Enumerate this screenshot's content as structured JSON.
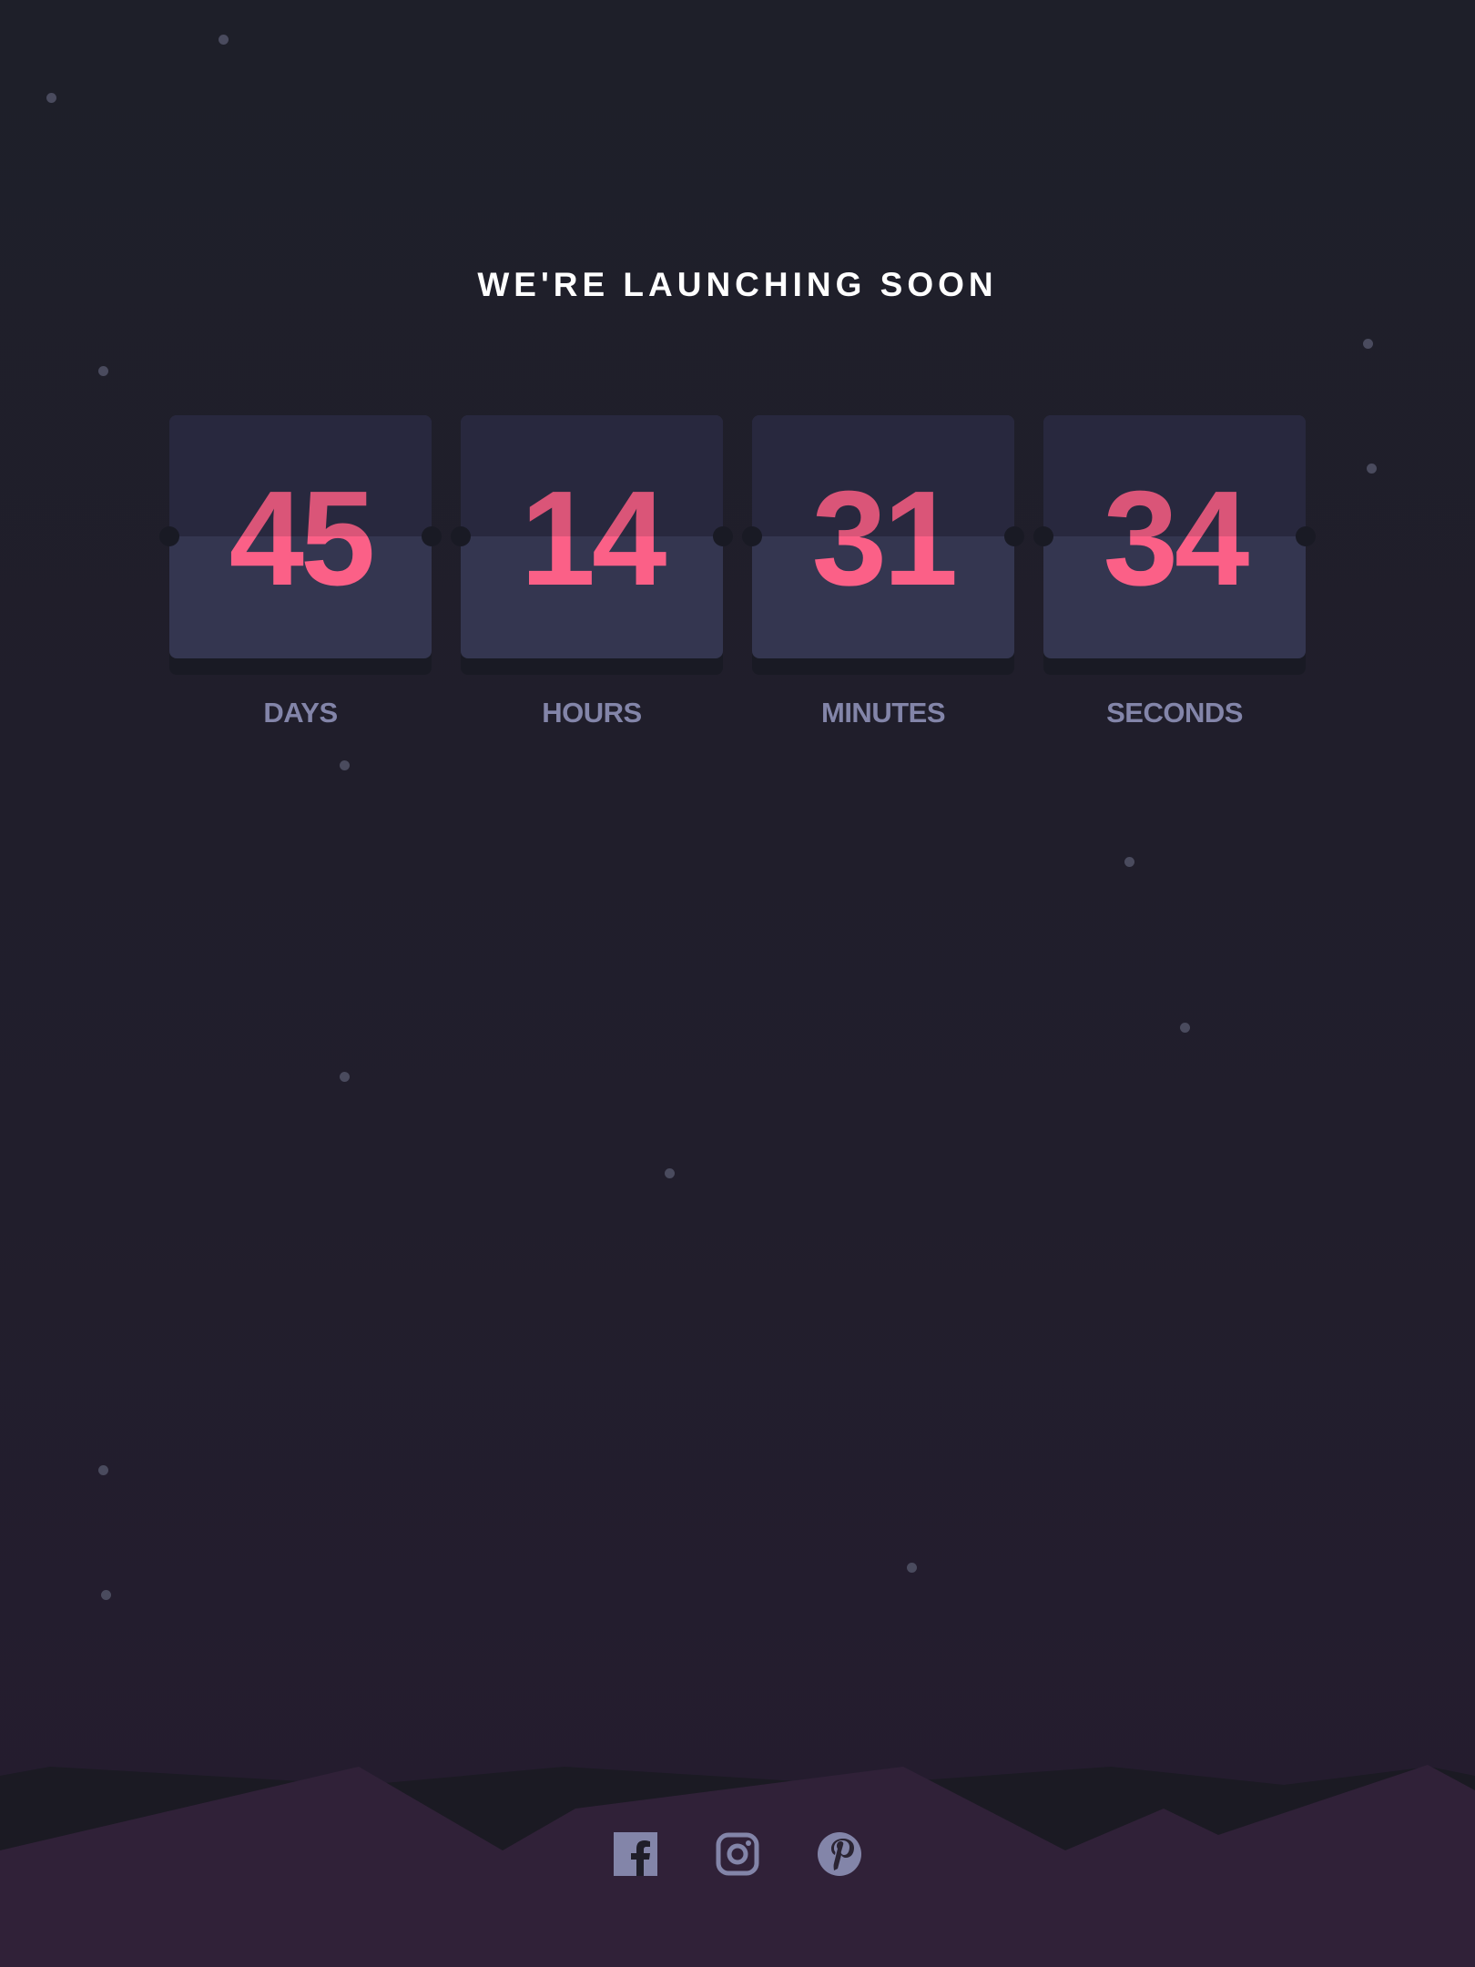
{
  "page": {
    "title": "WE'RE LAUNCHING SOON"
  },
  "countdown": [
    {
      "value": "45",
      "label": "DAYS"
    },
    {
      "value": "14",
      "label": "HOURS"
    },
    {
      "value": "31",
      "label": "MINUTES"
    },
    {
      "value": "34",
      "label": "SECONDS"
    }
  ],
  "social": [
    {
      "icon": "facebook-icon"
    },
    {
      "icon": "instagram-icon"
    },
    {
      "icon": "pinterest-icon"
    }
  ],
  "colors": {
    "background": "#1e1f29",
    "accent": "#fb6087",
    "label": "#8385a9",
    "card": "#343650",
    "hills": "#302138"
  }
}
